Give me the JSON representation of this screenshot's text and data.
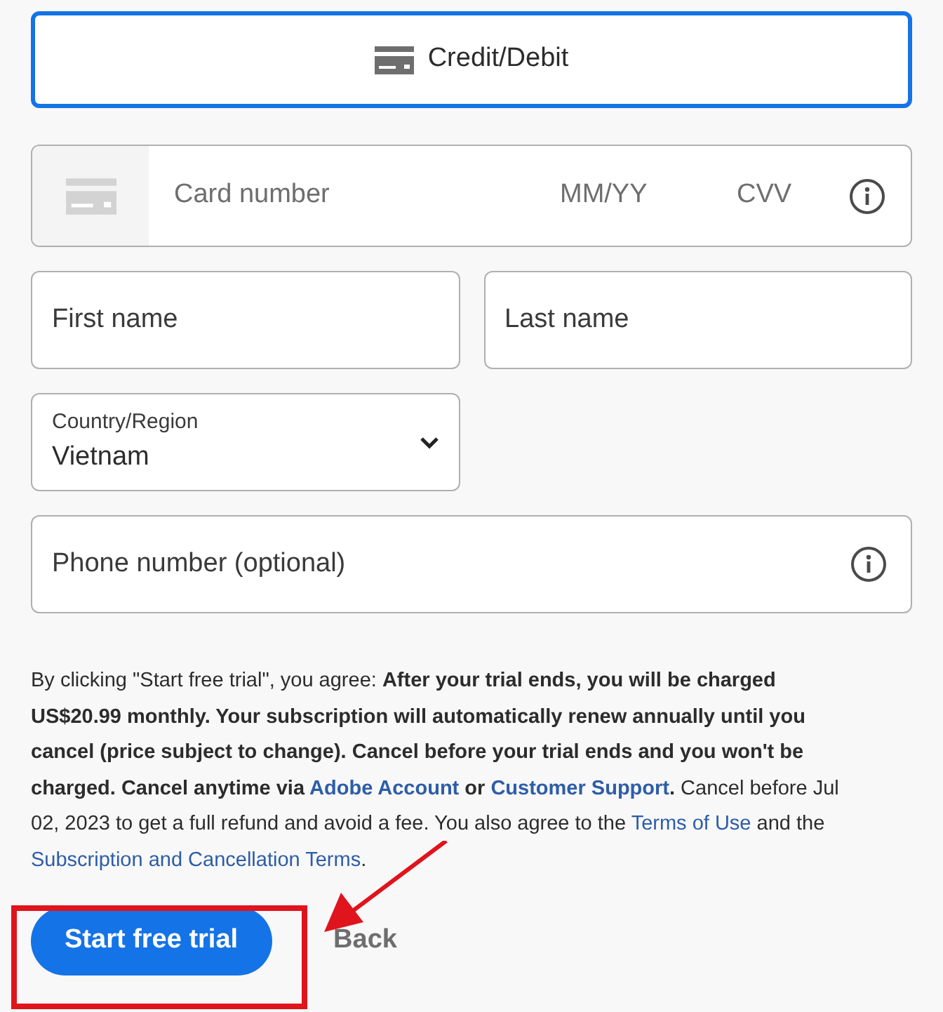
{
  "payment_method": {
    "label": "Credit/Debit",
    "selected": true
  },
  "card_field": {
    "card_number_placeholder": "Card number",
    "expiry_placeholder": "MM/YY",
    "cvv_placeholder": "CVV"
  },
  "first_name": {
    "placeholder": "First name"
  },
  "last_name": {
    "placeholder": "Last name"
  },
  "country": {
    "label": "Country/Region",
    "value": "Vietnam"
  },
  "phone": {
    "placeholder": "Phone number (optional)"
  },
  "legal_text": [
    {
      "kind": "plain",
      "text": "By clicking \"Start free trial\", you agree: "
    },
    {
      "kind": "bold",
      "text": "After your trial ends, you will be charged US$20.99 monthly. Your subscription will automatically renew annually until you cancel (price subject to change). Cancel before your trial ends and you won't be charged. Cancel anytime via "
    },
    {
      "kind": "link",
      "text": "Adobe Account",
      "bold": true
    },
    {
      "kind": "bold",
      "text": " or "
    },
    {
      "kind": "link",
      "text": "Customer Support",
      "bold": true
    },
    {
      "kind": "bold",
      "text": "."
    },
    {
      "kind": "plain",
      "text": " Cancel before Jul 02, 2023 to get a full refund and avoid a fee. You also agree to the "
    },
    {
      "kind": "link",
      "text": "Terms of Use",
      "bold": false
    },
    {
      "kind": "plain",
      "text": " and the "
    },
    {
      "kind": "link",
      "text": "Subscription and Cancellation Terms",
      "bold": false
    },
    {
      "kind": "plain",
      "text": "."
    }
  ],
  "buttons": [
    {
      "kind": "primary",
      "label": "Start free trial"
    },
    {
      "kind": "secondary",
      "label": "Back"
    }
  ],
  "annotations": [
    {
      "kind": "highlight-box"
    },
    {
      "kind": "arrow"
    }
  ]
}
